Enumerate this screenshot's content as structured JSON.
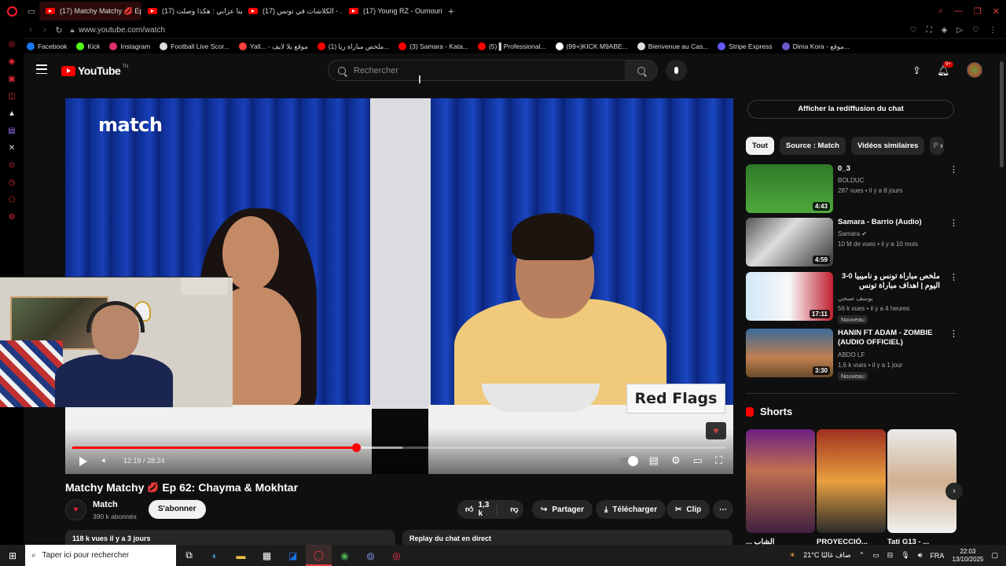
{
  "tabs": [
    {
      "title": "(17) Matchy Matchy 💋 Ep",
      "active": true
    },
    {
      "title": "(17) لينا عزابي : هكذا وصلت",
      "active": false
    },
    {
      "title": "(17) الكلاشات في تونس - ...",
      "active": false
    },
    {
      "title": "(17) Young RZ - Oumouri",
      "active": false
    }
  ],
  "address": {
    "url": "www.youtube.com/watch"
  },
  "bookmarks": [
    {
      "label": "Facebook",
      "color": "#1877f2"
    },
    {
      "label": "Kick",
      "color": "#53fc18"
    },
    {
      "label": "Instagram",
      "color": "#e1306c"
    },
    {
      "label": "Football Live Scor...",
      "color": "#dddddd"
    },
    {
      "label": "Yall... - موقع يلا لايف",
      "color": "#ff4040"
    },
    {
      "label": "(1) ملخص مباراة ريا...",
      "color": "#ff0000"
    },
    {
      "label": "(3) Samara - Kata...",
      "color": "#ff0000"
    },
    {
      "label": "(5) ▌Professional...",
      "color": "#ff0000"
    },
    {
      "label": "(99+)KICK M9ABE...",
      "color": "#ffffff"
    },
    {
      "label": "Bienvenue au Cas...",
      "color": "#dddddd"
    },
    {
      "label": "Stripe Express",
      "color": "#635bff"
    },
    {
      "label": "Dima Kora - موقع...",
      "color": "#6a5acd"
    }
  ],
  "header": {
    "logo_text": "YouTube",
    "logo_suffix": "TN",
    "search_placeholder": "Rechercher",
    "notif_count": "9+"
  },
  "player": {
    "brand": "match",
    "sign_text": "Red Flags",
    "time": "12:19 / 28:24",
    "progress": 0.434,
    "buffered": 0.505
  },
  "video": {
    "title": "Matchy Matchy",
    "title_emoji": "💋",
    "title_rest": "Ep 62: Chayma & Mokhtar",
    "channel": "Match",
    "subscribers": "390 k abonnés",
    "subscribe_label": "S'abonner",
    "likes": "1,3 k",
    "share_label": "Partager",
    "download_label": "Télécharger",
    "clip_label": "Clip",
    "views_date": "118 k vues  il y a 3 jours",
    "replay_label": "Replay du chat en direct"
  },
  "sidebar": {
    "chat_replay": "Afficher la rediffusion du chat",
    "chips": [
      "Tout",
      "Source : Match",
      "Vidéos similaires",
      "P"
    ],
    "recommendations": [
      {
        "title": "0_3",
        "channel": "BOLDUC",
        "meta": "287 vues • il y a 8 jours",
        "duration": "4:43",
        "badge": ""
      },
      {
        "title": "Samara - Barrio (Audio)",
        "channel": "Samara ✔",
        "meta": "10 M de vues • il y a 10 mois",
        "duration": "4:59",
        "badge": ""
      },
      {
        "title": "ملخص مباراة تونس و ناميبيا 0-3 اليوم | اهداف مباراة تونس وناميبيا اليوم | ملخص ...",
        "channel": "يوسف صبحي",
        "meta": "56 k vues • il y a 4 heures",
        "duration": "17:11",
        "badge": "Nouveau"
      },
      {
        "title": "HANIN FT ADAM - ZOMBIE (AUDIO OFFICIEL)",
        "channel": "ABDO LF",
        "meta": "1,6 k vues • il y a 1 jour",
        "duration": "3:30",
        "badge": "Nouveau"
      }
    ],
    "shorts_title": "Shorts",
    "shorts": [
      "الشاب ...",
      "PROYECCIÓ...",
      "Tati G13 - ..."
    ]
  },
  "taskbar": {
    "search_placeholder": "Taper ici pour rechercher",
    "weather": "21°C  صاف غالبًا",
    "lang": "FRA",
    "time": "22:03",
    "date": "13/10/2025"
  }
}
